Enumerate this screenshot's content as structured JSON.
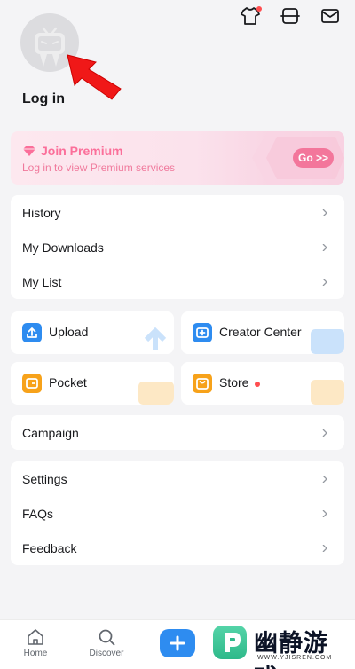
{
  "header": {
    "icons": [
      "shirt-icon",
      "scan-icon",
      "mail-icon"
    ],
    "login_label": "Log in"
  },
  "premium": {
    "title": "Join Premium",
    "subtitle": "Log in to view Premium services",
    "button_label": "Go >>",
    "accent": "#fb6f9a"
  },
  "list_primary": [
    {
      "label": "History"
    },
    {
      "label": "My Downloads"
    },
    {
      "label": "My List"
    }
  ],
  "tiles": [
    {
      "label": "Upload",
      "icon": "upload-icon",
      "color": "#2e8cf0"
    },
    {
      "label": "Creator Center",
      "icon": "creator-center-icon",
      "color": "#2e8cf0"
    },
    {
      "label": "Pocket",
      "icon": "wallet-icon",
      "color": "#f7a21a"
    },
    {
      "label": "Store",
      "icon": "store-icon",
      "color": "#f7a21a"
    }
  ],
  "list_campaign": [
    {
      "label": "Campaign"
    }
  ],
  "list_settings": [
    {
      "label": "Settings"
    },
    {
      "label": "FAQs"
    },
    {
      "label": "Feedback"
    }
  ],
  "bottom_nav": [
    {
      "label": "Home",
      "icon": "home-icon"
    },
    {
      "label": "Discover",
      "icon": "discover-icon"
    }
  ],
  "watermark": {
    "text": "幽静游戏",
    "url": "WWW.YJISREN.COM"
  }
}
